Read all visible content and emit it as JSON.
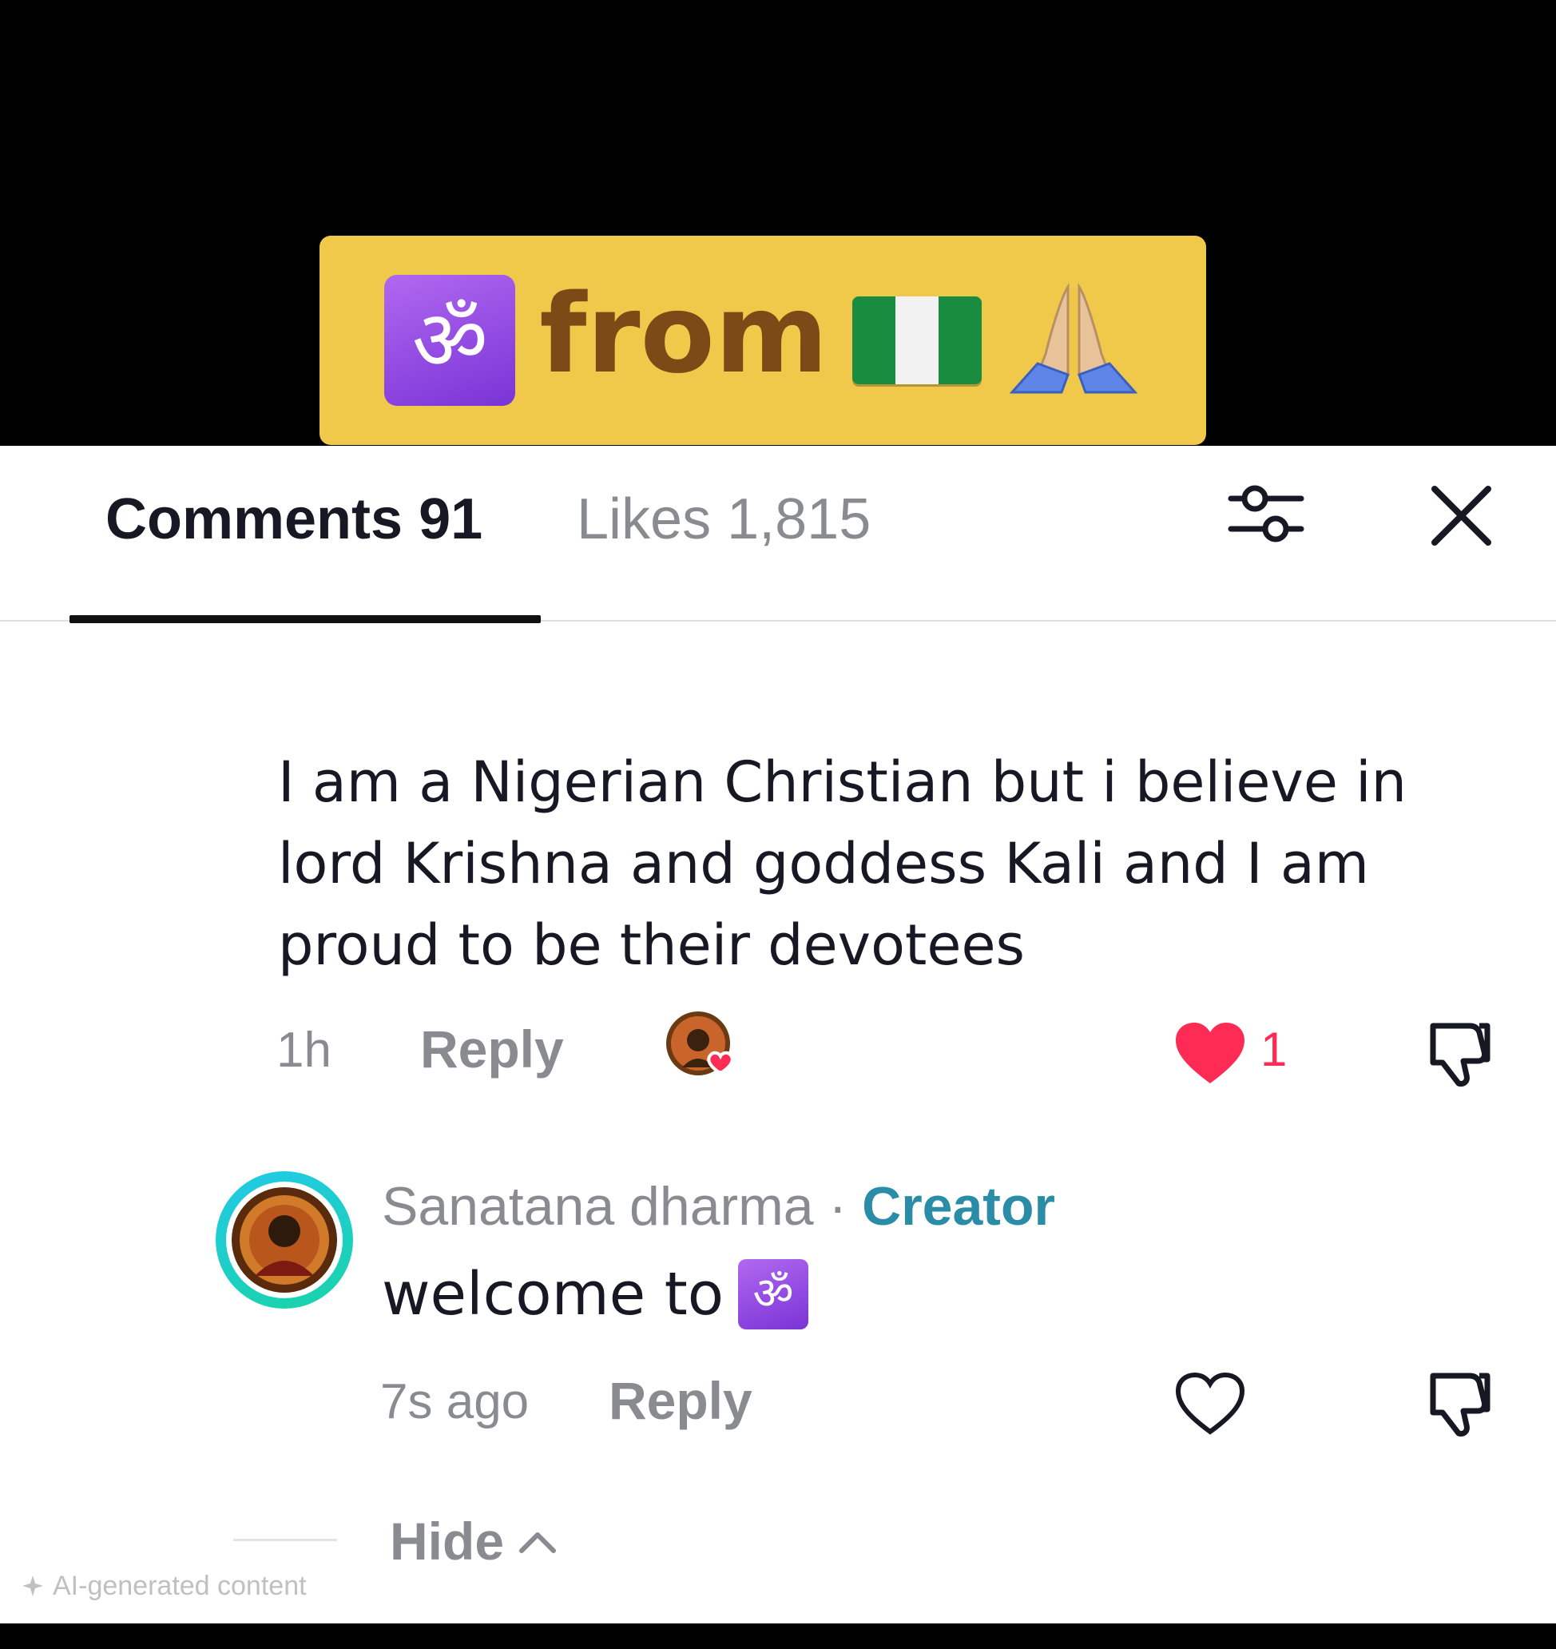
{
  "caption": {
    "om_symbol": "ॐ",
    "word": "from",
    "flag_icon": "nigeria-flag-icon",
    "prayer_icon": "folded-hands-icon"
  },
  "tabs": {
    "comments_label": "Comments 91",
    "likes_label": "Likes 1,815"
  },
  "comment": {
    "text": "I am a Nigerian Christian but i believe in lord Krishna and goddess Kali and I am proud to be their devotees",
    "time": "1h",
    "reply_label": "Reply",
    "like_count": "1"
  },
  "reply": {
    "author": "Sanatana dharma",
    "separator": "·",
    "badge": "Creator",
    "text": "welcome to",
    "om_symbol": "ॐ",
    "time": "7s ago",
    "reply_label": "Reply"
  },
  "hide_label": "Hide",
  "ai_note": "AI-generated content",
  "colors": {
    "caption_bg": "#f1c94a",
    "caption_text": "#7c4a16",
    "like_red": "#fe2c55",
    "creator_teal": "#2a8ca6",
    "om_purple": "#9a4fe6"
  }
}
